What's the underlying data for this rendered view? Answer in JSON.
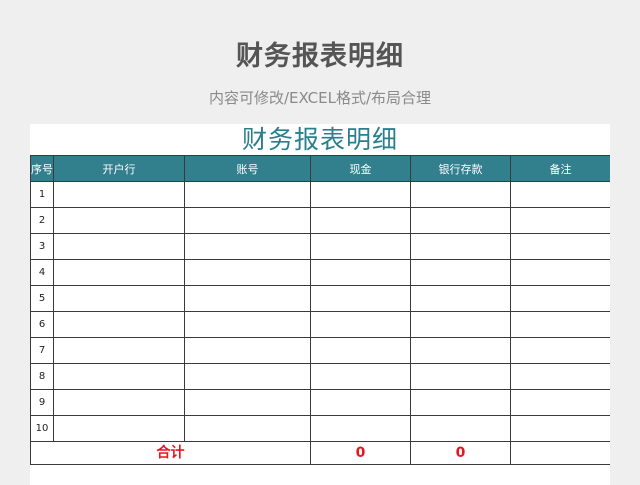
{
  "header": {
    "title": "财务报表明细",
    "subtitle": "内容可修改/EXCEL格式/布局合理"
  },
  "sheet": {
    "title": "财务报表明细",
    "columns": [
      "序号",
      "开户行",
      "账号",
      "现金",
      "银行存款",
      "备注"
    ],
    "rows": [
      "1",
      "2",
      "3",
      "4",
      "5",
      "6",
      "7",
      "8",
      "9",
      "10"
    ],
    "total": {
      "label": "合计",
      "cash": "0",
      "bank": "0"
    }
  },
  "colors": {
    "header_bg": "#327f8e",
    "title": "#2a7f8d",
    "total_text": "#e8141e",
    "page_bg": "#efefef"
  }
}
